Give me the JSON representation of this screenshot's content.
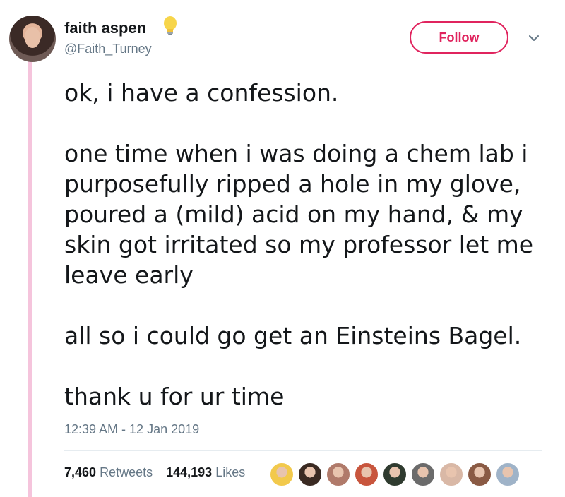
{
  "user": {
    "display_name": "faith aspen",
    "handle": "@Faith_Turney",
    "avatar_icon": "profile-photo",
    "badge_icon": "lightbulb-emoji"
  },
  "header": {
    "follow_label": "Follow",
    "menu_icon": "chevron-down-icon",
    "accent_color": "#e0245e"
  },
  "tweet": {
    "paragraphs": [
      "ok, i have a confession.",
      "one time when i was doing a chem lab i purposefully ripped a hole in my glove, poured a (mild) acid on my hand, & my skin got irritated so my professor let me leave early",
      "all so i could go get an Einsteins Bagel.",
      "thank u for ur time"
    ],
    "timestamp": "12:39 AM - 12 Jan 2019"
  },
  "stats": {
    "retweets_count": "7,460",
    "retweets_label": "Retweets",
    "likes_count": "144,193",
    "likes_label": "Likes"
  },
  "likers": [
    {
      "color": "#f2c94c"
    },
    {
      "color": "#3a2a22"
    },
    {
      "color": "#b07a6a"
    },
    {
      "color": "#c8553d"
    },
    {
      "color": "#2f3b2f"
    },
    {
      "color": "#6b6b6b"
    },
    {
      "color": "#d9b8a6"
    },
    {
      "color": "#8a5a44"
    },
    {
      "color": "#9fb3c8"
    }
  ]
}
